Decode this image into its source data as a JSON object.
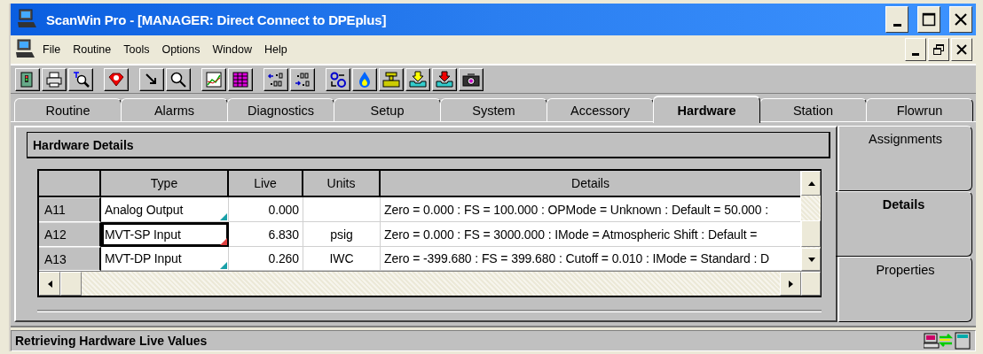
{
  "window": {
    "title": "ScanWin Pro - [MANAGER: Direct Connect to DPEplus]"
  },
  "menu": [
    "File",
    "Routine",
    "Tools",
    "Options",
    "Window",
    "Help"
  ],
  "tabs": [
    {
      "label": "Routine",
      "selected": false
    },
    {
      "label": "Alarms",
      "selected": false
    },
    {
      "label": "Diagnostics",
      "selected": false
    },
    {
      "label": "Setup",
      "selected": false
    },
    {
      "label": "System",
      "selected": false
    },
    {
      "label": "Accessory",
      "selected": false
    },
    {
      "label": "Hardware",
      "selected": true
    },
    {
      "label": "Station",
      "selected": false
    },
    {
      "label": "Flowrun",
      "selected": false
    }
  ],
  "panel": {
    "title": "Hardware Details"
  },
  "table": {
    "columns": [
      "Type",
      "Live",
      "Units",
      "Details"
    ],
    "rows": [
      {
        "id": "A11",
        "type": "Analog Output",
        "live": "0.000",
        "units": "",
        "details": "Zero = 0.000 : FS = 100.000 : OPMode = Unknown : Default = 50.000 :",
        "selected": false,
        "color": "#19a0a8"
      },
      {
        "id": "A12",
        "type": "MVT-SP Input",
        "live": "6.830",
        "units": "psig",
        "details": "Zero = 0.000 : FS = 3000.000 : IMode = Atmospheric Shift : Default =",
        "selected": true,
        "color": "#e04040"
      },
      {
        "id": "A13",
        "type": "MVT-DP Input",
        "live": "0.260",
        "units": "IWC",
        "details": "Zero = -399.680 : FS = 399.680 : Cutoff = 0.010 : IMode = Standard : D",
        "selected": false,
        "color": "#19a0a8"
      }
    ]
  },
  "side_tabs": [
    {
      "label": "Assignments",
      "selected": false
    },
    {
      "label": "Details",
      "selected": true
    },
    {
      "label": "Properties",
      "selected": false
    }
  ],
  "status_bar": {
    "text": "Retrieving Hardware Live Values"
  }
}
